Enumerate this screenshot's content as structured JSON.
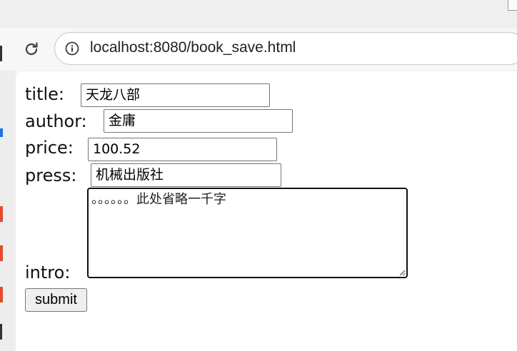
{
  "browser": {
    "url": "localhost:8080/book_save.html"
  },
  "form": {
    "title_label": "title:",
    "title_value": "天龙八部",
    "author_label": "author:",
    "author_value": "金庸",
    "price_label": "price:",
    "price_value": "100.52",
    "press_label": "press:",
    "press_value": "机械出版社",
    "intro_label": "intro:",
    "intro_value": "。。。。。。此处省略一千字",
    "submit_label": "submit"
  },
  "icons": {
    "reload": "reload-icon",
    "info": "info-icon"
  }
}
